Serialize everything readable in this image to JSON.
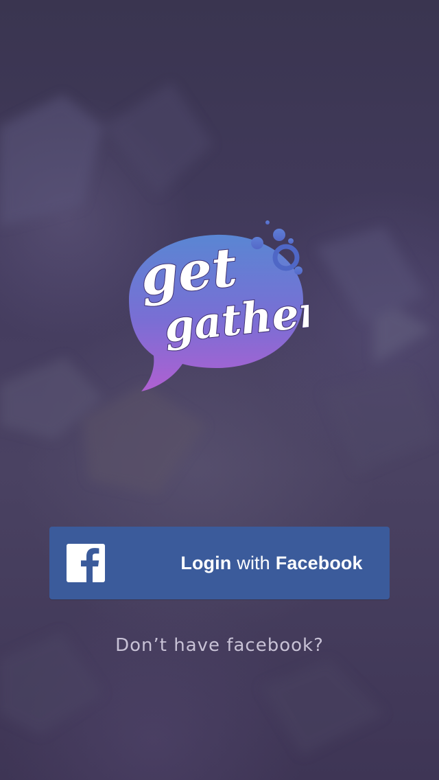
{
  "app": {
    "logo_line1": "get",
    "logo_line2": "gather"
  },
  "login": {
    "button_prefix": "Login",
    "button_middle": "with",
    "button_brand": "Facebook",
    "icon": "facebook-icon"
  },
  "alternate": {
    "link_text": "Don’t have facebook?"
  },
  "colors": {
    "facebook_blue": "#3b5b9b",
    "bubble_top": "#5a86d3",
    "bubble_bottom": "#b060d2",
    "background": "#433b5e"
  }
}
